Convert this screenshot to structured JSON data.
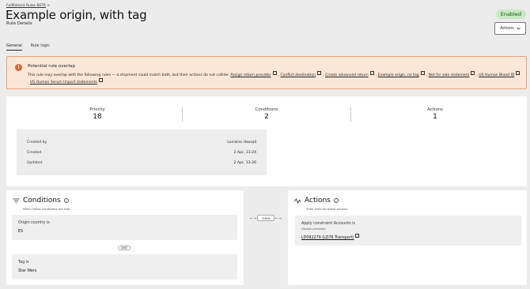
{
  "breadcrumb": {
    "parent": "Fulfillment Rules BETA",
    "separator": ">"
  },
  "header": {
    "title": "Example origin, with tag",
    "subtitle": "Rule Details",
    "status": "Enabled",
    "actions_label": "Actions"
  },
  "tabs": [
    {
      "label": "General",
      "active": true
    },
    {
      "label": "Rule logic",
      "active": false
    }
  ],
  "alert": {
    "title": "Potential rule overlap",
    "intro": "This rule may overlap with the following rules — a shipment could match both, but their actions do not collide:",
    "rules": [
      "Assign return provider",
      "Conflict destination",
      "Create advanced return",
      "Example origin, no tag",
      "Not for sale statement",
      "US Human Blood ID",
      "US Human Serum Import statements"
    ]
  },
  "stats": [
    {
      "label": "Priority",
      "value": "18"
    },
    {
      "label": "Conditions",
      "value": "2"
    },
    {
      "label": "Actions",
      "value": "1"
    }
  ],
  "meta": [
    {
      "label": "Created by",
      "value": "Lorraine Hassall"
    },
    {
      "label": "Created",
      "value": "2 Apr, 13:24"
    },
    {
      "label": "Updated",
      "value": "2 Apr, 13:26"
    }
  ],
  "conditions": {
    "title": "Conditions",
    "subtitle": "When these conditions are met",
    "items": [
      {
        "label": "Origin country is",
        "value": "ES"
      },
      {
        "label": "Tag is",
        "value": "Star Wars"
      }
    ],
    "joiner": "AND"
  },
  "then_label": "THEN",
  "actions": {
    "title": "Actions",
    "subtitle": "Then execute these actions",
    "item": {
      "line": "Apply constraint Accounts is",
      "note": "(Assign provider)",
      "link": "LD092279 (LD78 Transport)"
    }
  },
  "colors": {
    "enabled_bg": "#c9e9c4",
    "alert_bg": "#fbe7d8",
    "alert_border": "#e8a17c",
    "alert_icon": "#d9662c"
  },
  "icons": {
    "alert": "exclamation-circle-icon",
    "external": "external-link-icon",
    "conditions": "filter-lines-icon",
    "actions": "activity-icon",
    "chevron": "chevron-down-icon",
    "info": "info-icon"
  }
}
